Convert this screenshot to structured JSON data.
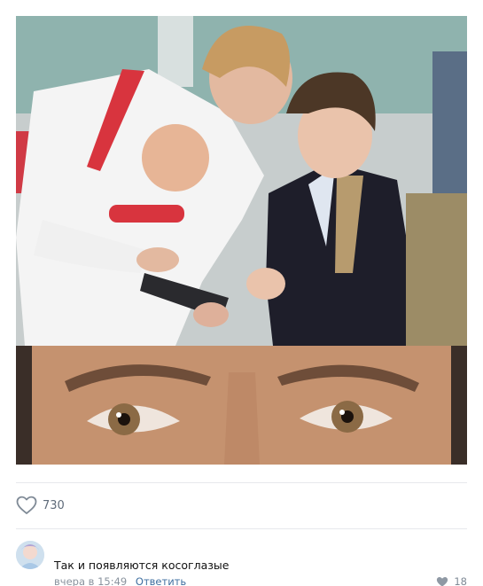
{
  "post": {
    "likes_count": "730"
  },
  "comment": {
    "text": "Так и появляются косоглазые",
    "time": "вчера в 15:49",
    "reply_label": "Ответить",
    "likes_count": "18"
  },
  "colors": {
    "link": "#3f6fa0",
    "meta": "#8a939e",
    "icon": "#7f8a96"
  },
  "icons": {
    "like": "heart-outline-icon",
    "comment_like": "heart-filled-icon"
  }
}
